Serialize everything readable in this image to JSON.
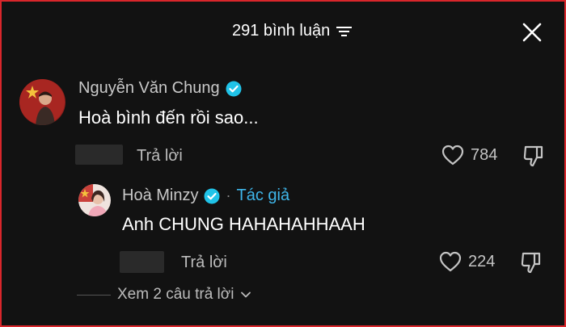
{
  "header": {
    "title": "291 bình luận",
    "filter_icon": "filter-lines-icon",
    "close_icon": "close-icon"
  },
  "comments": [
    {
      "author": "Nguyễn Văn Chung",
      "verified": true,
      "text": "Hoà bình đến rồi sao...",
      "reply_label": "Trả lời",
      "likes": "784",
      "avatar_colors": [
        "#b52a25",
        "#6b1412"
      ]
    },
    {
      "author": "Hoà Minzy",
      "verified": true,
      "tag": "Tác giả",
      "separator": "·",
      "text": "Anh CHUNG HAHAHAHHAAH",
      "reply_label": "Trả lời",
      "likes": "224",
      "avatar_colors": [
        "#f2d9d4",
        "#c9403a"
      ]
    }
  ],
  "view_more": {
    "label": "Xem 2 câu trả lời"
  },
  "colors": {
    "background": "#121212",
    "border": "#d9262b",
    "verified": "#20c3e8",
    "author_tag": "#3fb6ea"
  }
}
